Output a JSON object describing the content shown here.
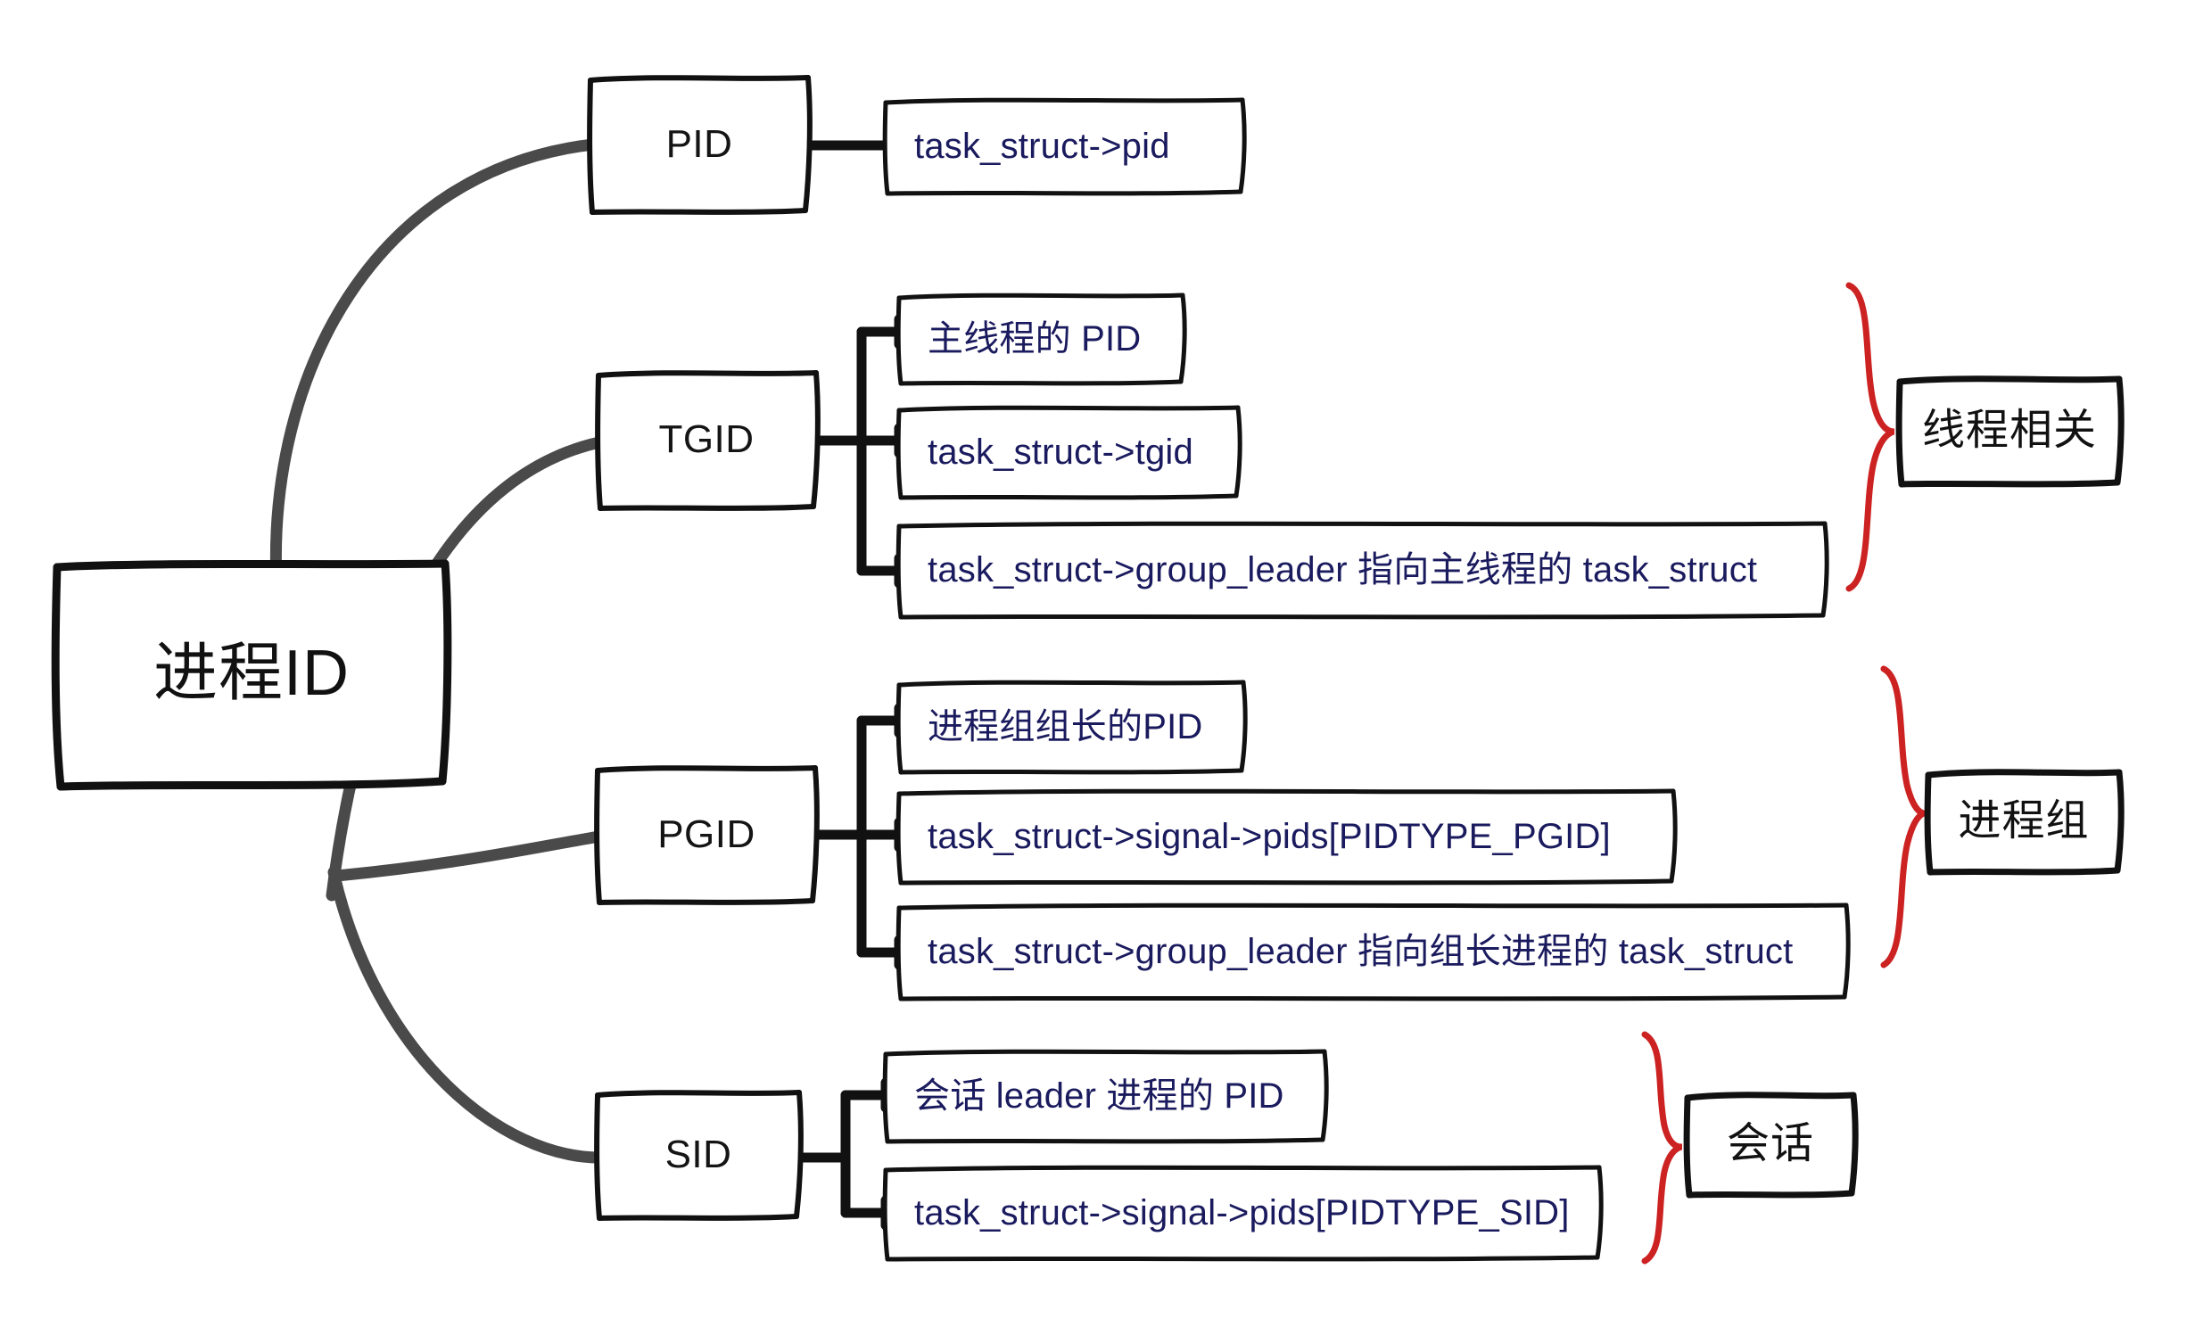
{
  "diagram": {
    "title": "进程ID",
    "root": {
      "label": "进程ID"
    },
    "branches": [
      {
        "id": "pid",
        "label": "PID",
        "details": [
          "task_struct->pid"
        ],
        "group": null
      },
      {
        "id": "tgid",
        "label": "TGID",
        "details": [
          "主线程的 PID",
          "task_struct->tgid",
          "task_struct->group_leader 指向主线程的 task_struct"
        ],
        "group": "线程相关"
      },
      {
        "id": "pgid",
        "label": "PGID",
        "details": [
          "进程组组长的PID",
          "task_struct->signal->pids[PIDTYPE_PGID]",
          "task_struct->group_leader 指向组长进程的 task_struct"
        ],
        "group": "进程组"
      },
      {
        "id": "sid",
        "label": "SID",
        "details": [
          "会话 leader 进程的 PID",
          "task_struct->signal->pids[PIDTYPE_SID]"
        ],
        "group": "会话"
      }
    ],
    "groups": [
      {
        "id": "thread",
        "label": "线程相关"
      },
      {
        "id": "pgroup",
        "label": "进程组"
      },
      {
        "id": "session",
        "label": "会话"
      }
    ],
    "colors": {
      "background": "#ffffff",
      "box_stroke": "#111111",
      "root_text": "#111111",
      "category_text": "#141414",
      "detail_text": "#1a1a5e",
      "curve_connector": "#4a4a4a",
      "branch_connector": "#111111",
      "brace": "#cc2222",
      "group_text": "#111111"
    }
  }
}
